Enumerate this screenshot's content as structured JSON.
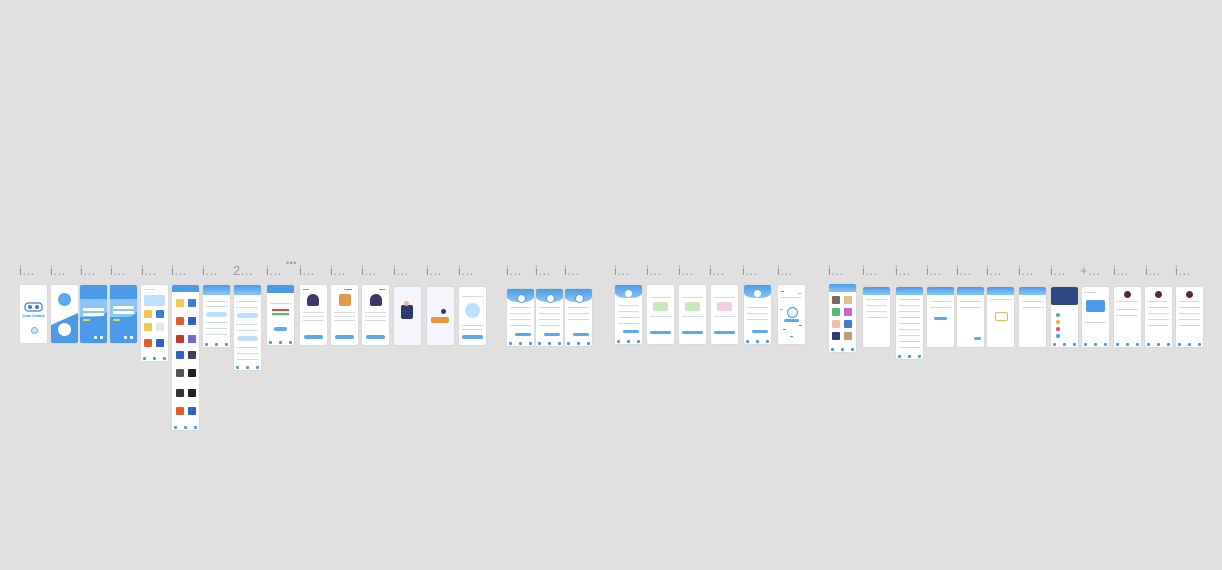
{
  "canvas": {
    "background": "#e0e0e0",
    "accent": "#4a9ae8",
    "accent_light": "#8cc6f4"
  },
  "frame_labels": [
    "i...",
    "i...",
    "i...",
    "i...",
    "i...",
    "i...",
    "i...",
    "2...",
    "i...",
    "i...",
    "i...",
    "i...",
    "i...",
    "i...",
    "i...",
    "i...",
    "i...",
    "i...",
    "i...",
    "i...",
    "i...",
    "i...",
    "i...",
    "i...",
    "i...",
    "i...",
    "i...",
    "i...",
    "i...",
    "i...",
    "i...",
    "i...",
    "i...",
    "+...",
    "i...",
    "i...",
    "i..."
  ],
  "overflow_badge": "•••",
  "splash": {
    "app_name": "Code Control"
  }
}
